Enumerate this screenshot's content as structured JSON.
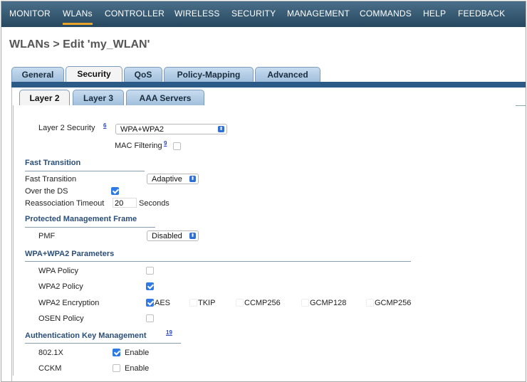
{
  "nav": {
    "items": [
      "MONITOR",
      "WLANs",
      "CONTROLLER",
      "WIRELESS",
      "SECURITY",
      "MANAGEMENT",
      "COMMANDS",
      "HELP",
      "FEEDBACK"
    ],
    "active": "WLANs"
  },
  "page": {
    "title": "WLANs > Edit  'my_WLAN'"
  },
  "tabs": {
    "items": [
      "General",
      "Security",
      "QoS",
      "Policy-Mapping",
      "Advanced"
    ],
    "active": "Security"
  },
  "subtabs": {
    "items": [
      "Layer 2",
      "Layer 3",
      "AAA Servers"
    ],
    "active": "Layer 2"
  },
  "layer2": {
    "security_label": "Layer 2 Security",
    "security_help": "6",
    "security_value": "WPA+WPA2",
    "mac_filtering_label": "MAC Filtering",
    "mac_filtering_help": "9",
    "mac_filtering_checked": false
  },
  "fast_transition": {
    "section": "Fast Transition",
    "ft_label": "Fast Transition",
    "ft_value": "Adaptive",
    "over_ds_label": "Over the DS",
    "over_ds_checked": true,
    "reassoc_label": "Reassociation Timeout",
    "reassoc_value": "20",
    "reassoc_unit": "Seconds"
  },
  "pmf": {
    "section": "Protected Management Frame",
    "label": "PMF",
    "value": "Disabled"
  },
  "wpa": {
    "section": "WPA+WPA2 Parameters",
    "wpa_policy_label": "WPA Policy",
    "wpa_policy_checked": false,
    "wpa2_policy_label": "WPA2 Policy",
    "wpa2_policy_checked": true,
    "wpa2_enc_label": "WPA2 Encryption",
    "enc_options": [
      {
        "label": "AES",
        "checked": true
      },
      {
        "label": "TKIP",
        "checked": false
      },
      {
        "label": "CCMP256",
        "checked": false
      },
      {
        "label": "GCMP128",
        "checked": false
      },
      {
        "label": "GCMP256",
        "checked": false
      }
    ],
    "osen_label": "OSEN Policy",
    "osen_checked": false
  },
  "akm": {
    "section": "Authentication Key Management",
    "help": "19",
    "rows": [
      {
        "label": "802.1X",
        "checked": true,
        "text": "Enable"
      },
      {
        "label": "CCKM",
        "checked": false,
        "text": "Enable"
      }
    ]
  },
  "colors": {
    "nav_bg": "#27485f",
    "active_underline": "#e8a32b",
    "tab_bg": "#9fbedb",
    "section_text": "#2b4f78",
    "check_blue": "#2f7ae5"
  }
}
